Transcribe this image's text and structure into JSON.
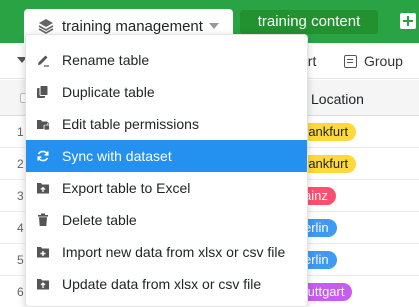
{
  "tabs": {
    "active_label": "training management",
    "other_label": "training content"
  },
  "toolbar": {
    "export_partial": "ort",
    "group_label": "Group"
  },
  "table": {
    "location_header": "Location",
    "rows": [
      {
        "num": "1",
        "location": "rankfurt",
        "color": "#ffd93b"
      },
      {
        "num": "2",
        "location": "rankfurt",
        "color": "#ffd93b"
      },
      {
        "num": "3",
        "location": "ainz",
        "color": "#ff4f6e"
      },
      {
        "num": "4",
        "location": "erlin",
        "color": "#3f9af2"
      },
      {
        "num": "5",
        "location": "erlin",
        "color": "#3f9af2"
      },
      {
        "num": "6",
        "location": "tuttgart",
        "color": "#c65cf0"
      }
    ]
  },
  "menu": {
    "items": [
      {
        "label": "Rename table",
        "icon": "pencil-icon"
      },
      {
        "label": "Duplicate table",
        "icon": "duplicate-icon"
      },
      {
        "label": "Edit table permissions",
        "icon": "lock-folder-icon"
      },
      {
        "label": "Sync with dataset",
        "icon": "sync-icon",
        "active": true
      },
      {
        "label": "Export table to Excel",
        "icon": "export-icon"
      },
      {
        "label": "Delete table",
        "icon": "trash-icon"
      },
      {
        "label": "Import new data from xlsx or csv file",
        "icon": "import-icon"
      },
      {
        "label": "Update data from xlsx or csv file",
        "icon": "update-icon"
      }
    ]
  },
  "colors": {
    "tabbar_green": "#2aa345",
    "menu_highlight": "#2490ef"
  }
}
